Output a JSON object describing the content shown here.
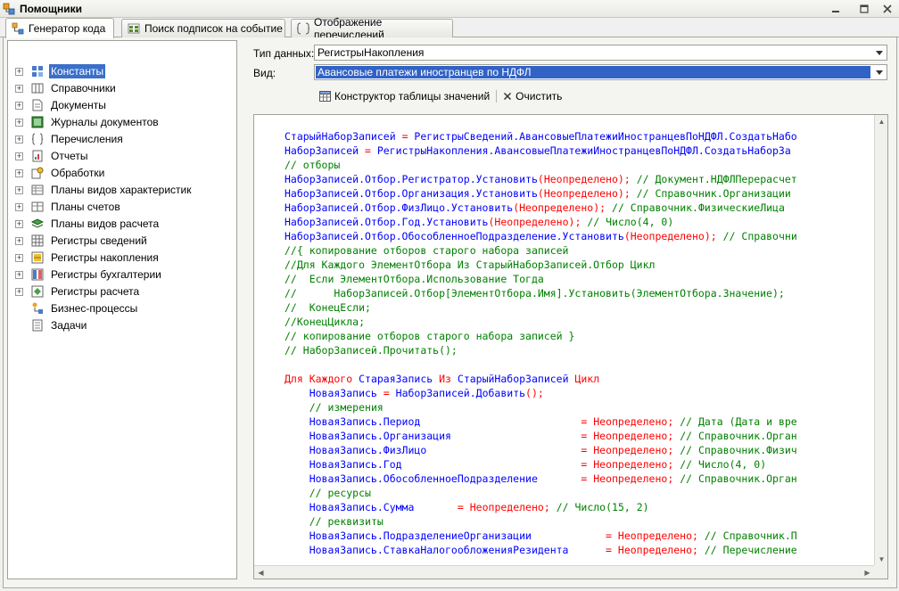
{
  "window": {
    "title": "Помощники"
  },
  "tabs": [
    {
      "label": "Генератор кода"
    },
    {
      "label": "Поиск подписок на событие"
    },
    {
      "label": "Отображение перечислений"
    }
  ],
  "tree": {
    "items": [
      {
        "label": "Константы",
        "icon": "constants-icon"
      },
      {
        "label": "Справочники",
        "icon": "catalogs-icon"
      },
      {
        "label": "Документы",
        "icon": "documents-icon"
      },
      {
        "label": "Журналы документов",
        "icon": "journals-icon"
      },
      {
        "label": "Перечисления",
        "icon": "enums-icon"
      },
      {
        "label": "Отчеты",
        "icon": "reports-icon"
      },
      {
        "label": "Обработки",
        "icon": "dataprocessors-icon"
      },
      {
        "label": "Планы видов характеристик",
        "icon": "chart-of-characteristics-icon"
      },
      {
        "label": "Планы счетов",
        "icon": "chart-of-accounts-icon"
      },
      {
        "label": "Планы видов расчета",
        "icon": "chart-of-calculation-icon"
      },
      {
        "label": "Регистры сведений",
        "icon": "information-registers-icon"
      },
      {
        "label": "Регистры накопления",
        "icon": "accumulation-registers-icon"
      },
      {
        "label": "Регистры бухгалтерии",
        "icon": "accounting-registers-icon"
      },
      {
        "label": "Регистры расчета",
        "icon": "calculation-registers-icon"
      },
      {
        "label": "Бизнес-процессы",
        "icon": "business-processes-icon"
      },
      {
        "label": "Задачи",
        "icon": "tasks-icon"
      }
    ]
  },
  "form": {
    "datatype_label": "Тип данных:",
    "datatype_value": "РегистрыНакопления",
    "kind_label": "Вид:",
    "kind_value": "Авансовые платежи иностранцев по НДФЛ"
  },
  "toolbar": {
    "constructor_label": "Конструктор таблицы значений",
    "clear_label": "Очистить"
  },
  "code": {
    "lines": [
      "СтарыйНаборЗаписей = РегистрыСведений.АвансовыеПлатежиИностранцевПоНДФЛ.СоздатьНабо",
      "НаборЗаписей = РегистрыНакопления.АвансовыеПлатежиИностранцевПоНДФЛ.СоздатьНаборЗа",
      "// отборы",
      "НаборЗаписей.Отбор.Регистратор.Установить(Неопределено); // Документ.НДФЛПерерасчет",
      "НаборЗаписей.Отбор.Организация.Установить(Неопределено); // Справочник.Организации",
      "НаборЗаписей.Отбор.ФизЛицо.Установить(Неопределено); // Справочник.ФизическиеЛица",
      "НаборЗаписей.Отбор.Год.Установить(Неопределено); // Число(4, 0)",
      "НаборЗаписей.Отбор.ОбособленноеПодразделение.Установить(Неопределено); // Справочни",
      "//{ копирование отборов старого набора записей",
      "//Для Каждого ЭлементОтбора Из СтарыйНаборЗаписей.Отбор Цикл",
      "//  Если ЭлементОтбора.Использование Тогда",
      "//      НаборЗаписей.Отбор[ЭлементОтбора.Имя].Установить(ЭлементОтбора.Значение);",
      "//  КонецЕсли;",
      "//КонецЦикла;",
      "// копирование отборов старого набора записей }",
      "// НаборЗаписей.Прочитать();",
      "",
      "Для Каждого СтараяЗапись Из СтарыйНаборЗаписей Цикл",
      "    НоваяЗапись = НаборЗаписей.Добавить();",
      "    // измерения",
      "    НоваяЗапись.Период                          = Неопределено; // Дата (Дата и вре",
      "    НоваяЗапись.Организация                     = Неопределено; // Справочник.Орган",
      "    НоваяЗапись.ФизЛицо                         = Неопределено; // Справочник.Физич",
      "    НоваяЗапись.Год                             = Неопределено; // Число(4, 0)",
      "    НоваяЗапись.ОбособленноеПодразделение       = Неопределено; // Справочник.Орган",
      "    // ресурсы",
      "    НоваяЗапись.Сумма       = Неопределено; // Число(15, 2)",
      "    // реквизиты",
      "    НоваяЗапись.ПодразделениеОрганизации            = Неопределено; // Справочник.П",
      "    НоваяЗапись.СтавкаНалогообложенияРезидента      = Неопределено; // Перечисление"
    ]
  },
  "colors": {
    "keyword": "#ff0000",
    "identifier": "#0000ff",
    "comment": "#008000",
    "selection": "#3162c5"
  }
}
